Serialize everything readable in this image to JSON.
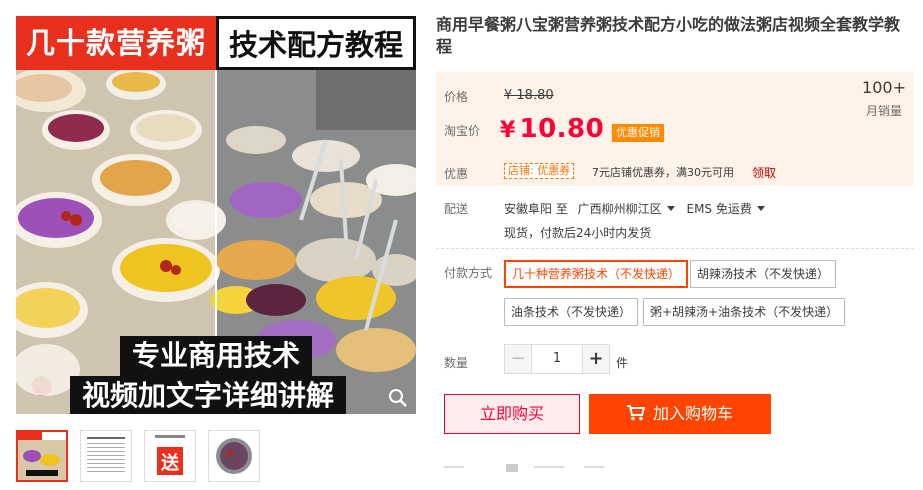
{
  "gallery": {
    "banner_left": "几十款营养粥",
    "banner_right": "技术配方教程",
    "caption_line1": "专业商用技术",
    "caption_line2": "视频加文字详细讲解",
    "zoom_icon": "magnifier-icon",
    "thumb2_text": "技术配方教程",
    "thumb3_text": "送"
  },
  "product": {
    "title": "商用早餐粥八宝粥营养粥技术配方小吃的做法粥店视频全套教学教程"
  },
  "price": {
    "label": "价格",
    "old_price": "¥ 18.80",
    "taobao_label": "淘宝价",
    "currency": "¥",
    "new_price": "10.80",
    "promo_tag": "优惠促销",
    "sales_count": "100+",
    "sales_label": "月销量",
    "coupon_label": "优惠",
    "coupon_tag": "店铺: 优惠券",
    "coupon_text": "7元店铺优惠券，满30元可用",
    "coupon_link": "领取"
  },
  "shipping": {
    "label": "配送",
    "from": "安徽阜阳 至",
    "to": "广西柳州柳江区",
    "method": "EMS 免运费",
    "note": "现货，付款后24小时内发货"
  },
  "payment": {
    "label": "付款方式",
    "options": [
      "几十种营养粥技术（不发快递）",
      "胡辣汤技术（不发快递）",
      "油条技术（不发快递）",
      "粥+胡辣汤+油条技术（不发快递）"
    ]
  },
  "quantity": {
    "label": "数量",
    "minus": "−",
    "value": "1",
    "plus": "+",
    "unit": "件"
  },
  "actions": {
    "buy_now": "立即购买",
    "add_to_cart": "加入购物车",
    "cart_icon": "cart-icon"
  },
  "colors": {
    "accent": "#ff4400",
    "price_red": "#ff0036",
    "price_bg": "#fff2e8"
  }
}
